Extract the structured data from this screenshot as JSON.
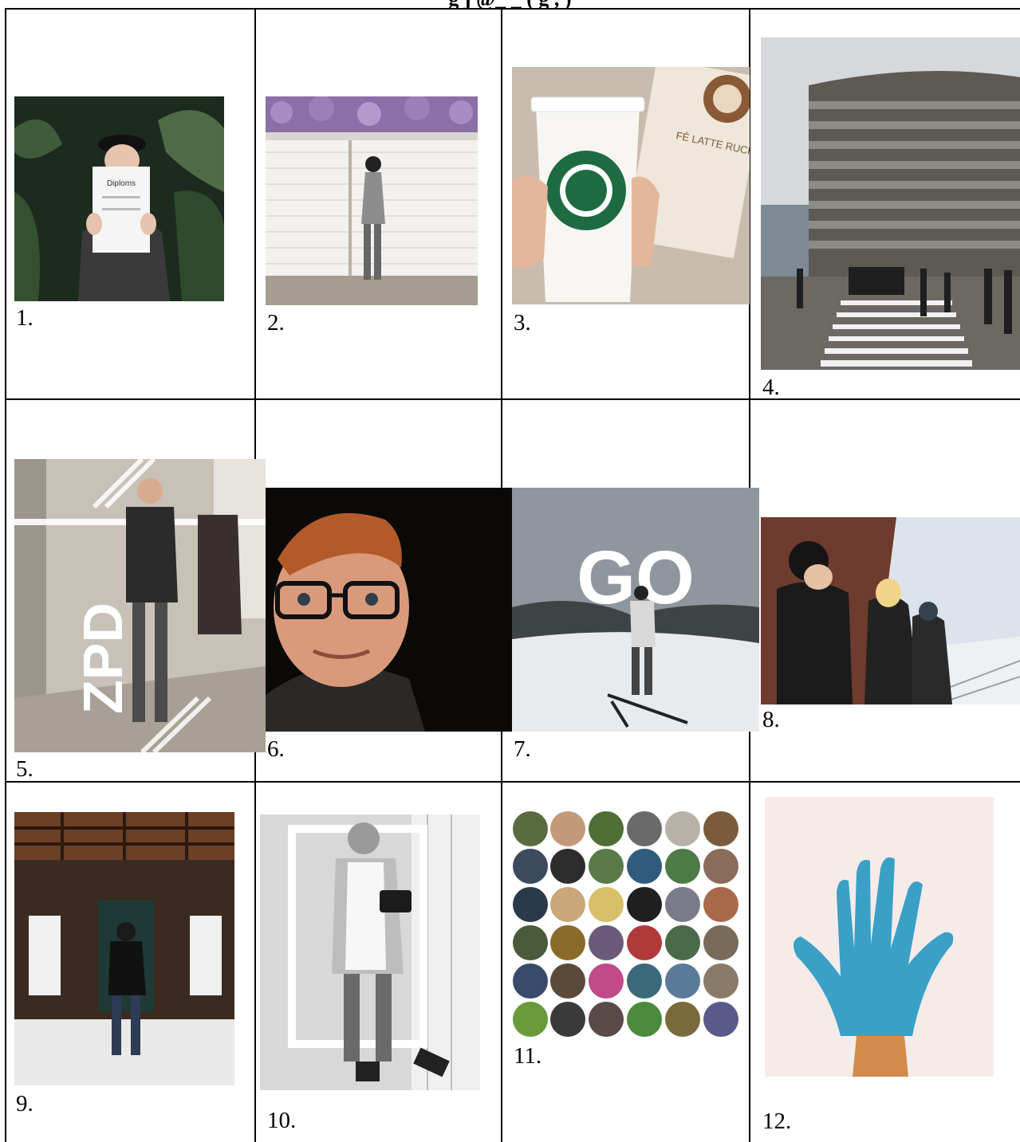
{
  "document": {
    "title": "g          j @_         _ (           g    ,          )"
  },
  "photos": [
    {
      "label": "1.",
      "icon": "portrait-diploma-photo",
      "text_on_photo": "Diploms"
    },
    {
      "label": "2.",
      "icon": "garage-door-wisteria-photo"
    },
    {
      "label": "3.",
      "icon": "coffee-cup-photo",
      "text_on_photo": "FÉ LATTE RUCKS"
    },
    {
      "label": "4.",
      "icon": "parliament-building-photo"
    },
    {
      "label": "5.",
      "icon": "hallway-zpd-photo",
      "text_on_photo": "ZPD"
    },
    {
      "label": "6.",
      "icon": "selfie-glasses-photo"
    },
    {
      "label": "7.",
      "icon": "ski-go-photo",
      "text_on_photo": "GO"
    },
    {
      "label": "8.",
      "icon": "railway-friends-photo"
    },
    {
      "label": "9.",
      "icon": "train-wagon-photo"
    },
    {
      "label": "10.",
      "icon": "camera-frame-photo"
    },
    {
      "label": "11.",
      "icon": "circle-collage-photo"
    },
    {
      "label": "12.",
      "icon": "blue-hand-photo"
    }
  ]
}
